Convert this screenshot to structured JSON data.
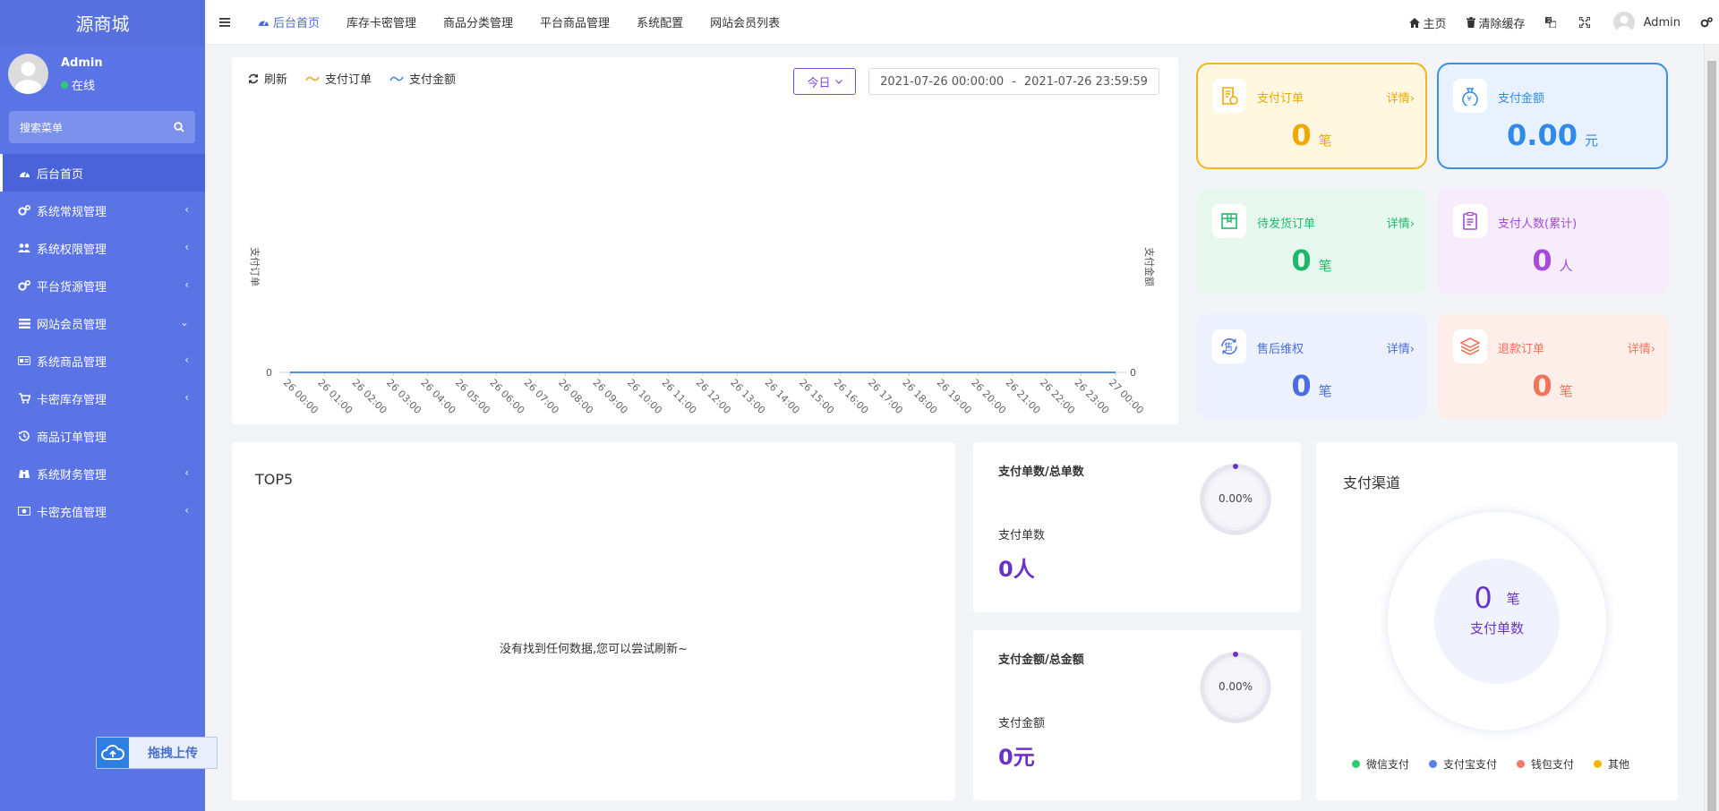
{
  "sidebar": {
    "brand": "源商城",
    "user": {
      "name": "Admin",
      "status": "在线"
    },
    "search_label": "搜索菜单",
    "items": [
      {
        "label": "后台首页",
        "icon": "dashboard-icon",
        "arrow": ""
      },
      {
        "label": "系统常规管理",
        "icon": "gears-icon",
        "arrow": "‹"
      },
      {
        "label": "系统权限管理",
        "icon": "users-icon",
        "arrow": "‹"
      },
      {
        "label": "平台货源管理",
        "icon": "gears-icon",
        "arrow": "‹"
      },
      {
        "label": "网站会员管理",
        "icon": "list-icon",
        "arrow": "⌄"
      },
      {
        "label": "系统商品管理",
        "icon": "card-icon",
        "arrow": "‹"
      },
      {
        "label": "卡密库存管理",
        "icon": "cart-icon",
        "arrow": "‹"
      },
      {
        "label": "商品订单管理",
        "icon": "history-icon",
        "arrow": ""
      },
      {
        "label": "系统财务管理",
        "icon": "binoculars-icon",
        "arrow": "‹"
      },
      {
        "label": "卡密充值管理",
        "icon": "money-icon",
        "arrow": "‹"
      }
    ],
    "upload_label": "拖拽上传"
  },
  "topbar": {
    "tabs": [
      "后台首页",
      "库存卡密管理",
      "商品分类管理",
      "平台商品管理",
      "系统配置",
      "网站会员列表"
    ],
    "home_label": "主页",
    "clear_cache_label": "清除缓存",
    "user_name": "Admin"
  },
  "chart_panel": {
    "refresh_label": "刷新",
    "legend_orders": "支付订单",
    "legend_amount": "支付金额",
    "today_label": "今日",
    "date_start": "2021-07-26 00:00:00",
    "date_sep": "-",
    "date_end": "2021-07-26 23:59:59"
  },
  "chart_data": {
    "type": "line",
    "x": [
      "26 00:00",
      "26 01:00",
      "26 02:00",
      "26 03:00",
      "26 04:00",
      "26 05:00",
      "26 06:00",
      "26 07:00",
      "26 08:00",
      "26 09:00",
      "26 10:00",
      "26 11:00",
      "26 12:00",
      "26 13:00",
      "26 14:00",
      "26 15:00",
      "26 16:00",
      "26 17:00",
      "26 18:00",
      "26 19:00",
      "26 20:00",
      "26 21:00",
      "26 22:00",
      "26 23:00",
      "27 00:00"
    ],
    "series": [
      {
        "name": "支付订单",
        "color": "#f5a623",
        "values": [
          0,
          0,
          0,
          0,
          0,
          0,
          0,
          0,
          0,
          0,
          0,
          0,
          0,
          0,
          0,
          0,
          0,
          0,
          0,
          0,
          0,
          0,
          0,
          0,
          0
        ]
      },
      {
        "name": "支付金额",
        "color": "#4a90e2",
        "values": [
          0,
          0,
          0,
          0,
          0,
          0,
          0,
          0,
          0,
          0,
          0,
          0,
          0,
          0,
          0,
          0,
          0,
          0,
          0,
          0,
          0,
          0,
          0,
          0,
          0
        ]
      }
    ],
    "ylabel_left": "支付订单",
    "ylabel_right": "支付金额",
    "y_tick_left": "0",
    "y_tick_right": "0"
  },
  "stats": [
    {
      "title": "支付订单",
      "detail": "详情›",
      "value": "0",
      "unit": "笔",
      "color": "#f0a800",
      "bg": "#fff7e0",
      "border": "#f3b51c"
    },
    {
      "title": "支付金额",
      "detail": "",
      "value": "0.00",
      "unit": "元",
      "color": "#2f8ae8",
      "bg": "#e8f2ff",
      "border": "#3a8ee8"
    },
    {
      "title": "待发货订单",
      "detail": "详情›",
      "value": "0",
      "unit": "笔",
      "color": "#1fb86a",
      "bg": "#e7f8ef",
      "border": "#e7f8ef"
    },
    {
      "title": "支付人数(累计)",
      "detail": "",
      "value": "0",
      "unit": "人",
      "color": "#a64bd8",
      "bg": "#f6ecfc",
      "border": "#f6ecfc"
    },
    {
      "title": "售后维权",
      "detail": "详情›",
      "value": "0",
      "unit": "笔",
      "color": "#4a6ee0",
      "bg": "#edf0fd",
      "border": "#edf0fd"
    },
    {
      "title": "退款订单",
      "detail": "详情›",
      "value": "0",
      "unit": "笔",
      "color": "#f0745a",
      "bg": "#fdeeea",
      "border": "#fdeeea"
    }
  ],
  "top5": {
    "title": "TOP5",
    "empty_text": "没有找到任何数据,您可以尝试刷新~"
  },
  "ratios": [
    {
      "title": "支付单数/总单数",
      "percent": "0.00%",
      "label": "支付单数",
      "value": "0人"
    },
    {
      "title": "支付金额/总金额",
      "percent": "0.00%",
      "label": "支付金额",
      "value": "0元"
    }
  ],
  "channel": {
    "title": "支付渠道",
    "count": "0",
    "unit": "笔",
    "center_label": "支付单数",
    "legend": [
      {
        "name": "微信支付",
        "color": "#2ecc71"
      },
      {
        "name": "支付宝支付",
        "color": "#5b7ff0"
      },
      {
        "name": "钱包支付",
        "color": "#f07a6a"
      },
      {
        "name": "其他",
        "color": "#f5b800"
      }
    ]
  }
}
